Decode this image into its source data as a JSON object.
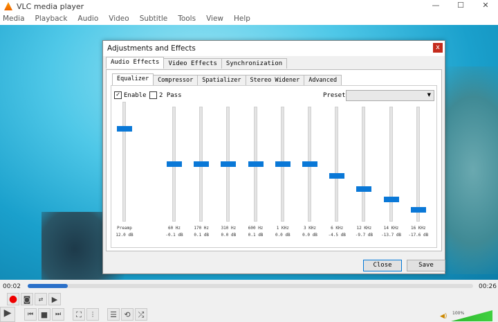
{
  "window": {
    "title": "VLC media player",
    "minimize": "—",
    "maximize": "☐",
    "close": "✕"
  },
  "menu": [
    "Media",
    "Playback",
    "Audio",
    "Video",
    "Subtitle",
    "Tools",
    "View",
    "Help"
  ],
  "dialog": {
    "title": "Adjustments and Effects",
    "close": "x",
    "tabs": [
      "Audio Effects",
      "Video Effects",
      "Synchronization"
    ],
    "subtabs": [
      "Equalizer",
      "Compressor",
      "Spatializer",
      "Stereo Widener",
      "Advanced"
    ],
    "enable": {
      "label": "Enable",
      "checked": true
    },
    "two_pass": {
      "label": "2 Pass",
      "checked": false
    },
    "preset_label": "Preset",
    "preset_value": "",
    "preamp": {
      "label": "Preamp",
      "value": 12.0,
      "value_label": "12.0 dB"
    },
    "bands": [
      {
        "freq": "60 Hz",
        "value": -0.1,
        "label": "-0.1 dB"
      },
      {
        "freq": "170 Hz",
        "value": 0.1,
        "label": "0.1 dB"
      },
      {
        "freq": "310 Hz",
        "value": 0.0,
        "label": "0.0 dB"
      },
      {
        "freq": "600 Hz",
        "value": 0.1,
        "label": "0.1 dB"
      },
      {
        "freq": "1 KHz",
        "value": 0.0,
        "label": "0.0 dB"
      },
      {
        "freq": "3 KHz",
        "value": 0.0,
        "label": "0.0 dB"
      },
      {
        "freq": "6 KHz",
        "value": -4.5,
        "label": "-4.5 dB"
      },
      {
        "freq": "12 KHz",
        "value": -9.7,
        "label": "-9.7 dB"
      },
      {
        "freq": "14 KHz",
        "value": -13.7,
        "label": "-13.7 dB"
      },
      {
        "freq": "16 KHz",
        "value": -17.6,
        "label": "-17.6 dB"
      }
    ],
    "range_db": [
      -20,
      20
    ],
    "close_button": "Close",
    "save_button": "Save"
  },
  "player": {
    "elapsed": "00:02",
    "total": "00:26",
    "progress": 0.09,
    "volume_label": "100%",
    "volume": 1.0
  }
}
